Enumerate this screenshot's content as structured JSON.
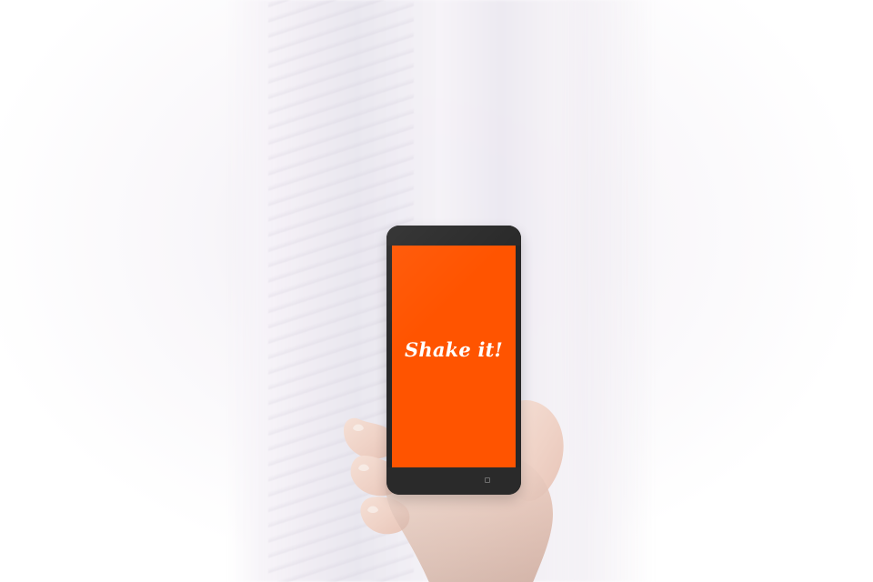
{
  "phone": {
    "screen_text": "Shake it!",
    "screen_color": "#ff5400"
  },
  "icons": {
    "home_sensor": "home-sensor-icon"
  }
}
